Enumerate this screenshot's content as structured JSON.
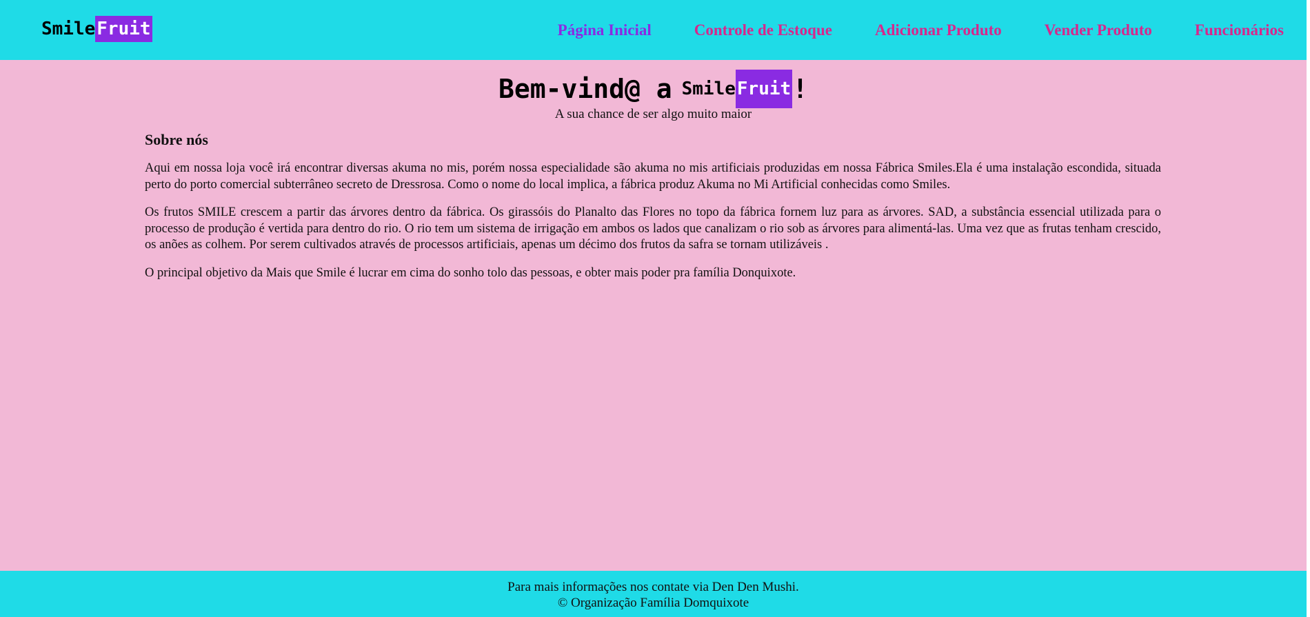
{
  "header": {
    "logo": {
      "part1": "Smile",
      "part2": "Fruit"
    },
    "nav": [
      {
        "label": "Página Inicial",
        "active": true
      },
      {
        "label": "Controle de Estoque",
        "active": false
      },
      {
        "label": "Adicionar Produto",
        "active": false
      },
      {
        "label": "Vender Produto",
        "active": false
      },
      {
        "label": "Funcionários",
        "active": false
      }
    ]
  },
  "hero": {
    "welcome_prefix": "Bem-vind@ a",
    "brand_part1": "Smile",
    "brand_part2": "Fruit",
    "welcome_suffix": "!",
    "tagline": "A sua chance de ser algo muito maior"
  },
  "about": {
    "heading": "Sobre nós",
    "paragraphs": [
      "Aqui em nossa loja você irá encontrar diversas akuma no mis, porém nossa especialidade são akuma no mis artificiais produzidas em nossa Fábrica Smiles.Ela é uma instalação escondida, situada perto do porto comercial subterrâneo secreto de Dressrosa. Como o nome do local implica, a fábrica produz Akuma no Mi Artificial conhecidas como Smiles.",
      "Os frutos SMILE crescem a partir das árvores dentro da fábrica. Os girassóis do Planalto das Flores no topo da fábrica fornem luz para as árvores. SAD, a substância essencial utilizada para o processo de produção é vertida para dentro do rio. O rio tem um sistema de irrigação em ambos os lados que canalizam o rio sob as árvores para alimentá-las. Uma vez que as frutas tenham crescido, os anões as colhem. Por serem cultivados através de processos artificiais, apenas um décimo dos frutos da safra se tornam utilizáveis .",
      "O principal objetivo da Mais que Smile é lucrar em cima do sonho tolo das pessoas, e obter mais poder pra família Donquixote."
    ]
  },
  "footer": {
    "contact": "Para mais informações nos contate via Den Den Mushi.",
    "copyright": "© Organização Família Domquixote"
  },
  "colors": {
    "navbar_bg": "#1fdbe7",
    "page_bg": "#f2b8d6",
    "nav_link": "#d6288c",
    "nav_active": "#8a2be2",
    "brand_highlight": "#8a2be2"
  }
}
